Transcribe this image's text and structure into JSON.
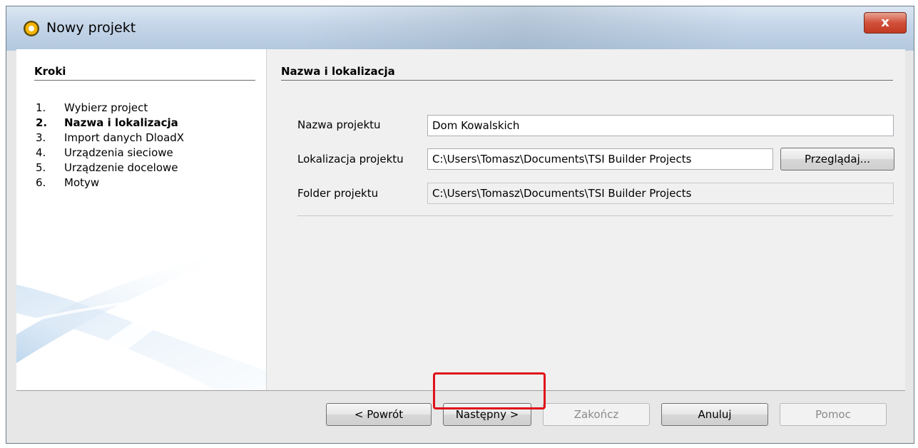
{
  "window": {
    "title": "Nowy projekt",
    "close_label": "x"
  },
  "sidebar": {
    "title": "Kroki",
    "steps": [
      {
        "num": "1.",
        "label": "Wybierz project"
      },
      {
        "num": "2.",
        "label": "Nazwa i lokalizacja"
      },
      {
        "num": "3.",
        "label": "Import danych DloadX"
      },
      {
        "num": "4.",
        "label": "Urządzenia sieciowe"
      },
      {
        "num": "5.",
        "label": "Urządzenie docelowe"
      },
      {
        "num": "6.",
        "label": "Motyw"
      }
    ],
    "active_step": 2
  },
  "panel": {
    "title": "Nazwa i lokalizacja",
    "fields": {
      "name_label": "Nazwa projektu",
      "name_value": "Dom Kowalskich",
      "location_label": "Lokalizacja projektu",
      "location_value": "C:\\Users\\Tomasz\\Documents\\TSI Builder Projects",
      "browse_label": "Przeglądaj...",
      "folder_label": "Folder projektu",
      "folder_value": "C:\\Users\\Tomasz\\Documents\\TSI Builder Projects"
    }
  },
  "footer": {
    "back_label": "< Powrót",
    "next_label": "Następny >",
    "finish_label": "Zakończ",
    "cancel_label": "Anuluj",
    "help_label": "Pomoc"
  },
  "colors": {
    "highlight": "#e0101a"
  }
}
